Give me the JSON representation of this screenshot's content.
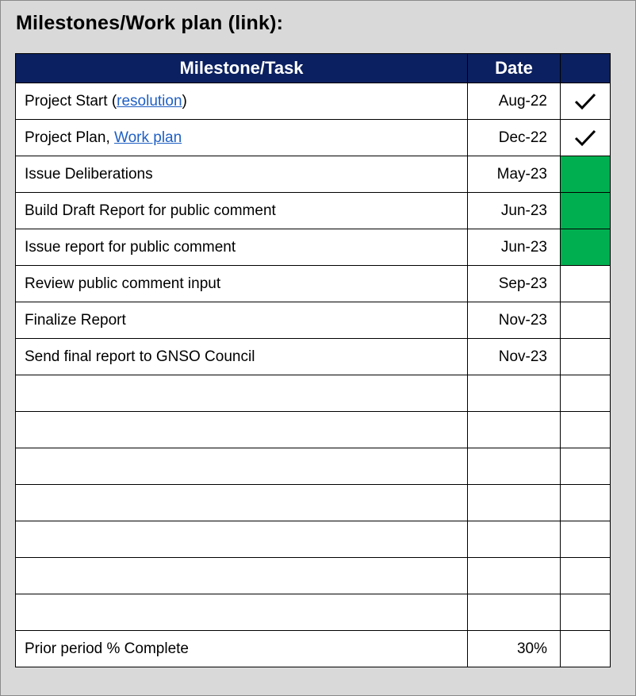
{
  "title": "Milestones/Work plan (link):",
  "colors": {
    "header_bg": "#0b2060",
    "complete_green": "#00b050",
    "link": "#1f5fc4"
  },
  "table": {
    "headers": {
      "task": "Milestone/Task",
      "date": "Date",
      "status": ""
    },
    "rows": [
      {
        "task_prefix": "Project Start (",
        "task_link": "resolution",
        "task_suffix": ")",
        "date": "Aug-22",
        "status": "check"
      },
      {
        "task_prefix": "Project Plan, ",
        "task_link": "Work plan",
        "task_suffix": "",
        "date": "Dec-22",
        "status": "check"
      },
      {
        "task": "Issue Deliberations",
        "date": "May-23",
        "status": "green"
      },
      {
        "task": "Build Draft Report for public comment",
        "date": "Jun-23",
        "status": "green"
      },
      {
        "task": "Issue report for public comment",
        "date": "Jun-23",
        "status": "green"
      },
      {
        "task": "Review public comment input",
        "date": "Sep-23",
        "status": ""
      },
      {
        "task": "Finalize Report",
        "date": "Nov-23",
        "status": ""
      },
      {
        "task": "Send final report to GNSO Council",
        "date": "Nov-23",
        "status": ""
      },
      {
        "task": "",
        "date": "",
        "status": ""
      },
      {
        "task": "",
        "date": "",
        "status": ""
      },
      {
        "task": "",
        "date": "",
        "status": ""
      },
      {
        "task": "",
        "date": "",
        "status": ""
      },
      {
        "task": "",
        "date": "",
        "status": ""
      },
      {
        "task": "",
        "date": "",
        "status": ""
      },
      {
        "task": "",
        "date": "",
        "status": ""
      }
    ],
    "footer": {
      "label": "Prior period % Complete",
      "value": "30%"
    }
  }
}
